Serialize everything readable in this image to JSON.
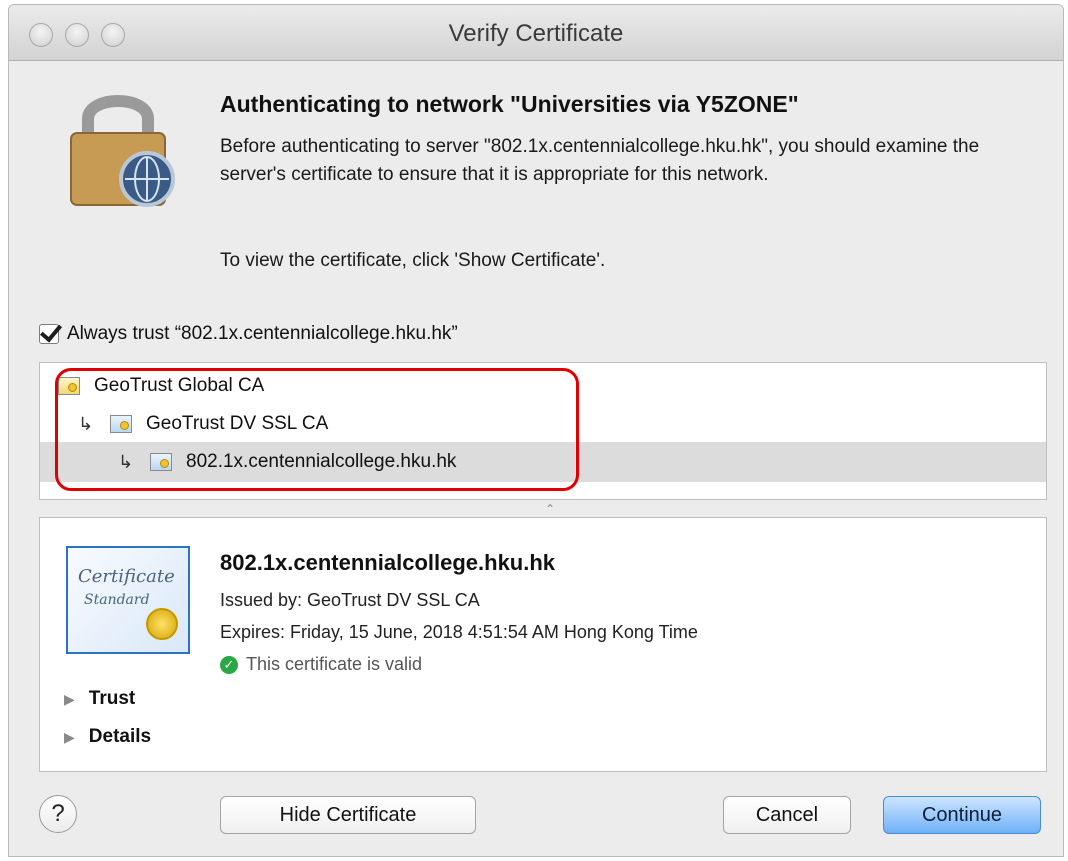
{
  "window": {
    "title": "Verify Certificate"
  },
  "message": {
    "heading": "Authenticating to network \"Universities via Y5ZONE\"",
    "body": "Before authenticating to server \"802.1x.centennialcollege.hku.hk\", you should examine the server's certificate to ensure that it is appropriate for this network.",
    "hint": "To view the certificate, click 'Show Certificate'."
  },
  "trust_checkbox": {
    "checked": true,
    "label": "Always trust “802.1x.centennialcollege.hku.hk”"
  },
  "cert_chain": [
    {
      "label": "GeoTrust Global CA",
      "icon": "root-certificate-icon"
    },
    {
      "label": "GeoTrust DV SSL CA",
      "icon": "intermediate-certificate-icon"
    },
    {
      "label": "802.1x.centennialcollege.hku.hk",
      "icon": "leaf-certificate-icon",
      "selected": true
    }
  ],
  "detail": {
    "name": "802.1x.centennialcollege.hku.hk",
    "issued_by": "Issued by: GeoTrust DV SSL CA",
    "expires": "Expires: Friday, 15 June, 2018 4:51:54 AM Hong Kong Time",
    "status": "This certificate is valid",
    "icon_title": "Certificate",
    "icon_subtitle": "Standard",
    "sections": [
      "Trust",
      "Details"
    ]
  },
  "buttons": {
    "help": "?",
    "hide": "Hide Certificate",
    "cancel": "Cancel",
    "continue": "Continue"
  },
  "colors": {
    "highlight_outline": "#e00000",
    "default_button": "#6fb1f8",
    "valid_status": "#2aa846"
  }
}
